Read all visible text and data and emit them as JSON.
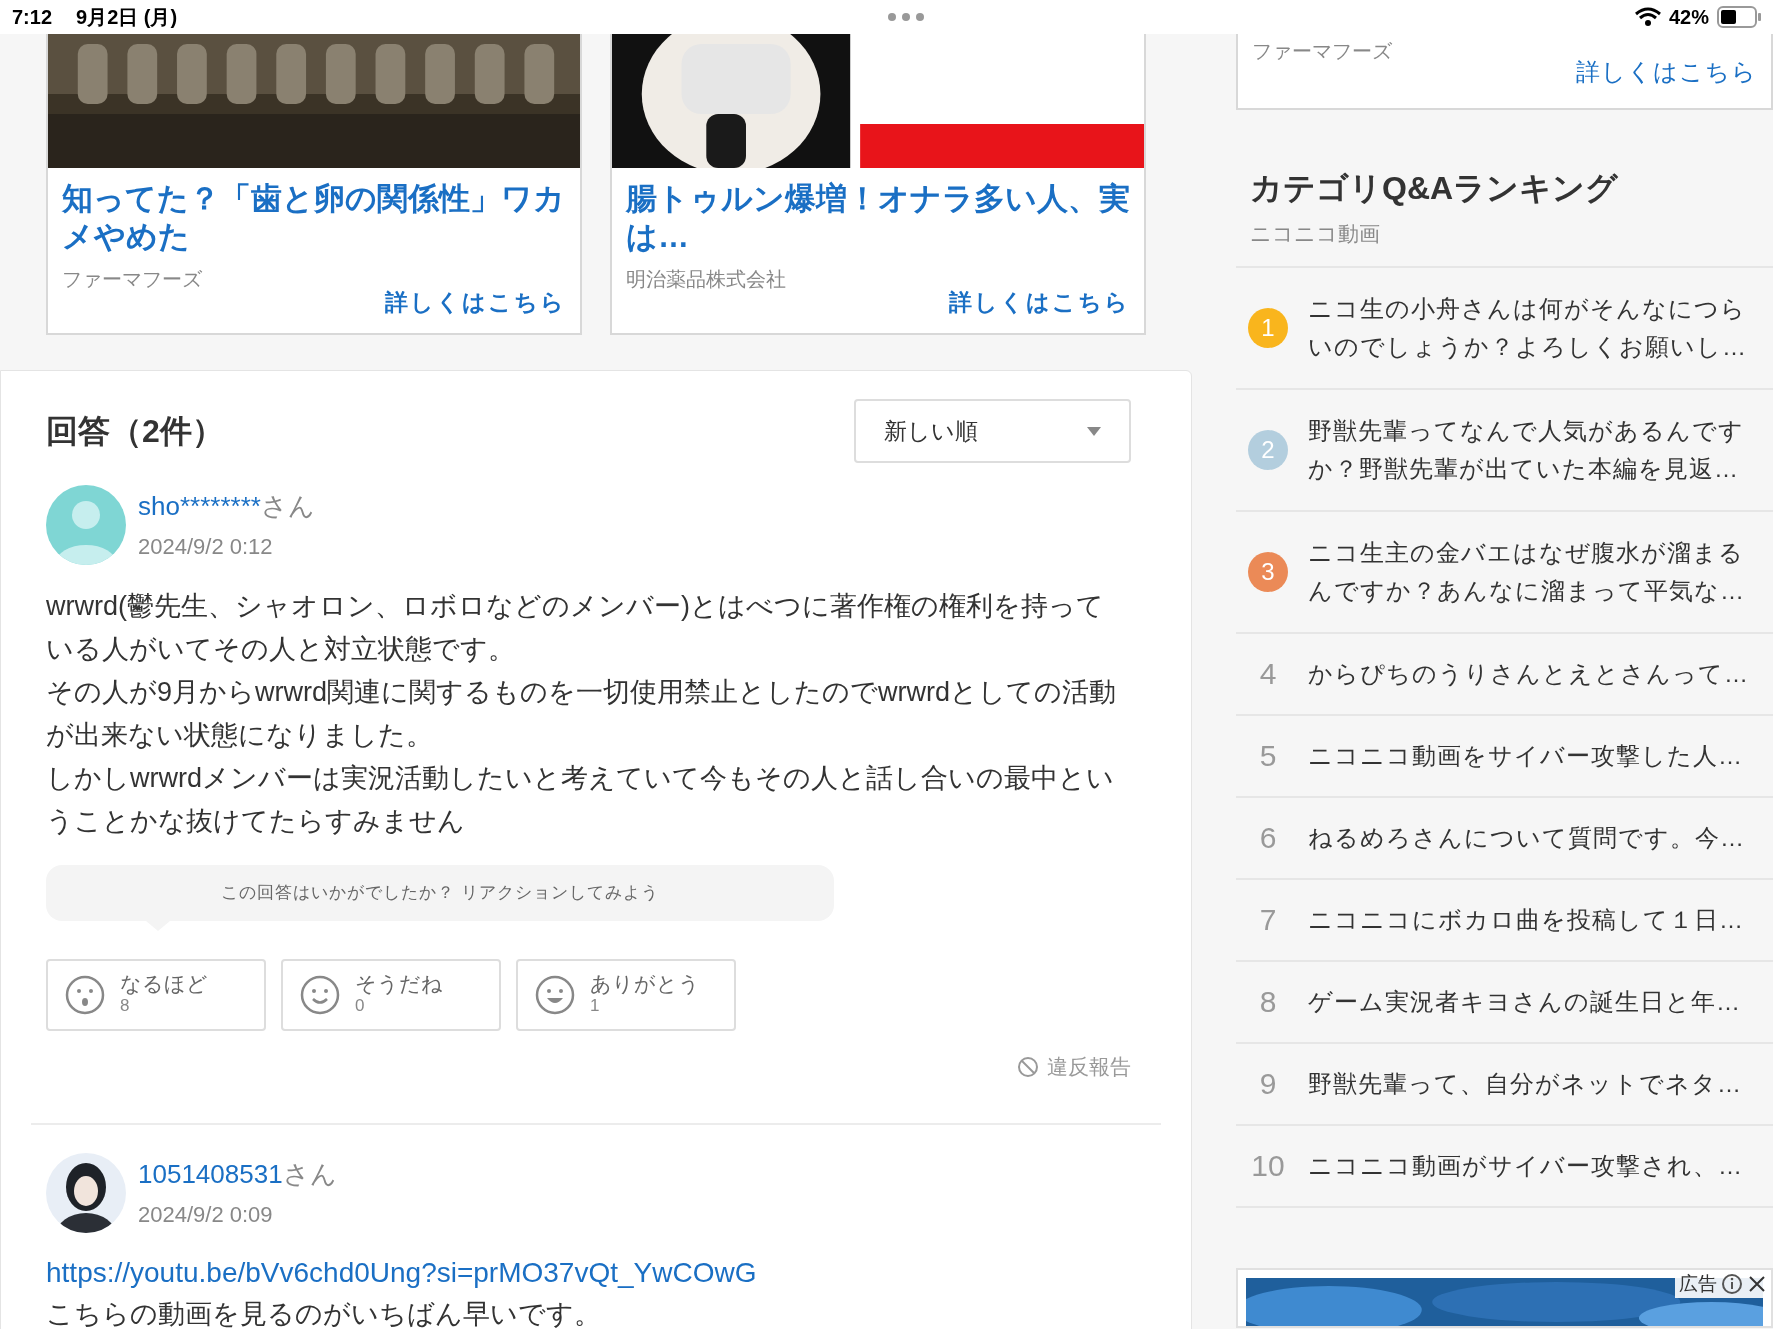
{
  "status_bar": {
    "time": "7:12",
    "date": "9月2日 (月)",
    "battery": "42%"
  },
  "ads": [
    {
      "title": "知ってた？「歯と卵の関係性」ワカメやめた",
      "sponsor": "ファーマフーズ",
      "link": "詳しくはこちら",
      "kind": "teeth"
    },
    {
      "title": "腸トゥルン爆増！オナラ多い人、実は…",
      "sponsor": "明治薬品株式会社",
      "link": "詳しくはこちら",
      "kind": "mask"
    }
  ],
  "answers": {
    "heading": "回答（2件）",
    "sort": "新しい順",
    "items": [
      {
        "user": "sho********",
        "suffix": "さん",
        "date": "2024/9/2 0:12",
        "kind": "default",
        "body": [
          "wrwrd(鬱先生、シャオロン、ロボロなどのメンバー)とはべつに著作権の権利を持っている人がいてその人と対立状態です。",
          "その人が9月からwrwrd関連に関するものを一切使用禁止としたのでwrwrdとしての活動が出来ない状態になりました。",
          "しかしwrwrdメンバーは実況活動したいと考えていて今もその人と話し合いの最中ということかな抜けてたらすみません"
        ],
        "prompt": "この回答はいかがでしたか？ リアクションしてみよう",
        "reactions": [
          {
            "label": "なるほど",
            "count": "8",
            "kind": "wow"
          },
          {
            "label": "そうだね",
            "count": "0",
            "kind": "smile"
          },
          {
            "label": "ありがとう",
            "count": "1",
            "kind": "grin"
          }
        ],
        "report": "違反報告"
      },
      {
        "user": "1051408531",
        "suffix": "さん",
        "date": "2024/9/2 0:09",
        "kind": "custom",
        "link": "https://youtu.be/bVv6chd0Ung?si=prMO37vQt_YwCOwG",
        "body": [
          "こちらの動画を見るのがいちばん早いです。"
        ]
      }
    ]
  },
  "sidebar": {
    "top_ad": {
      "sponsor": "ファーマフーズ",
      "link": "詳しくはこちら"
    },
    "ranking": {
      "title": "カテゴリQ&Aランキング",
      "subtitle": "ニコニコ動画",
      "items": [
        {
          "rank": "1",
          "color": "#f9b51d",
          "text": "ニコ生の小舟さんは何がそんなにつらいのでしょうか？よろしくお願いし…"
        },
        {
          "rank": "2",
          "color": "#b3cede",
          "text": "野獣先輩ってなんで人気があるんですか？野獣先輩が出ていた本編を見返…"
        },
        {
          "rank": "3",
          "color": "#eb8a57",
          "text": "ニコ生主の金バエはなぜ腹水が溜まるんですか？あんなに溜まって平気な…"
        },
        {
          "rank": "4",
          "text": "からぴちのうりさんとえとさんって…"
        },
        {
          "rank": "5",
          "text": "ニコニコ動画をサイバー攻撃した人…"
        },
        {
          "rank": "6",
          "text": "ねるめろさんについて質問です。今…"
        },
        {
          "rank": "7",
          "text": "ニコニコにボカロ曲を投稿して１日…"
        },
        {
          "rank": "8",
          "text": "ゲーム実況者キヨさんの誕生日と年…"
        },
        {
          "rank": "9",
          "text": "野獣先輩って、自分がネットでネタ…"
        },
        {
          "rank": "10",
          "text": "ニコニコ動画がサイバー攻撃され、…"
        }
      ]
    },
    "bottom_ad": {
      "label": "広告"
    }
  }
}
